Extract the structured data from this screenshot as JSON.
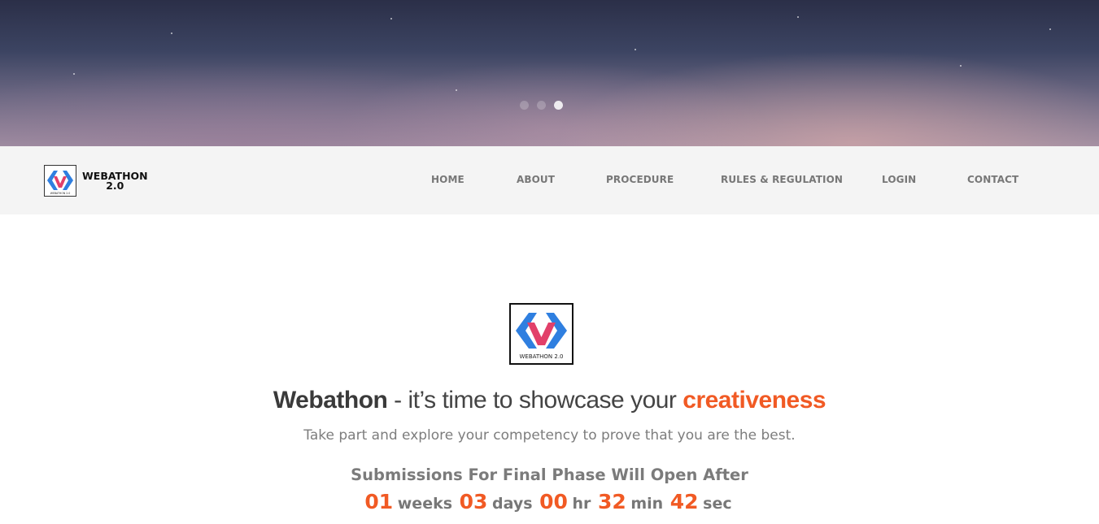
{
  "hero": {
    "slides": [
      {
        "label": "slide-1",
        "active": false
      },
      {
        "label": "slide-2",
        "active": false
      },
      {
        "label": "slide-3",
        "active": true
      }
    ]
  },
  "navbar": {
    "brand": {
      "line1": "WEBATHON",
      "line2": "2.0",
      "logo_caption": "WEBATHON 2.0"
    },
    "links": [
      {
        "label": "HOME"
      },
      {
        "label": "ABOUT"
      },
      {
        "label": "PROCEDURE"
      },
      {
        "label": "RULES & REGULATION"
      },
      {
        "label": "LOGIN"
      },
      {
        "label": "CONTACT"
      }
    ]
  },
  "main": {
    "logo_caption": "WEBATHON 2.0",
    "headline": {
      "strong": "Webathon",
      "middle": " - it’s time to showcase your ",
      "accent": "creativeness"
    },
    "tagline": "Take part and explore your competency to prove that you are the best.",
    "phase_text": "Submissions For Final Phase Will Open After",
    "countdown": {
      "weeks": "01",
      "weeks_label": "weeks",
      "days": "03",
      "days_label": "days",
      "hours": "00",
      "hours_label": "hr",
      "minutes": "32",
      "minutes_label": "min",
      "seconds": "42",
      "seconds_label": "sec"
    }
  },
  "colors": {
    "accent": "#f15a24",
    "nav_bg": "#f4f4f4",
    "nav_text": "#777777",
    "logo_blue": "#2f7fe0",
    "logo_pink": "#e2406a"
  }
}
